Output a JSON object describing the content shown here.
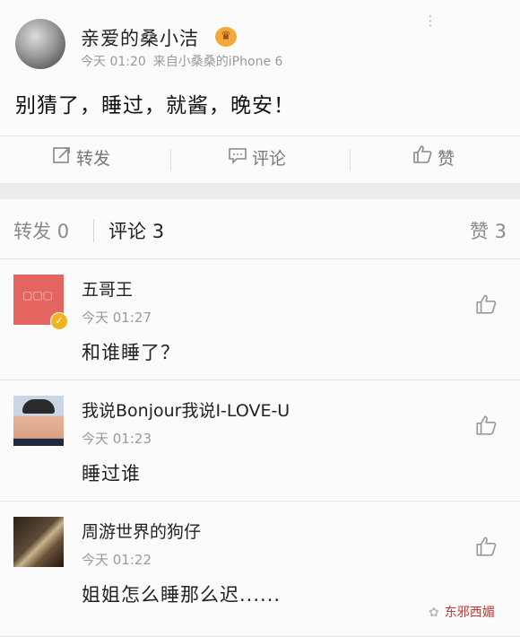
{
  "post": {
    "username": "亲爱的桑小洁",
    "time": "今天 01:20",
    "source": "来自小桑桑的iPhone 6",
    "text": "别猜了，睡过，就酱，晚安！",
    "more_icon": "more-icon"
  },
  "actions": {
    "forward_label": "转发",
    "comment_label": "评论",
    "like_label": "赞"
  },
  "tabs": {
    "forward_label": "转发",
    "forward_count": "0",
    "comment_label": "评论",
    "comment_count": "3",
    "like_label": "赞",
    "like_count": "3"
  },
  "comments": [
    {
      "name": "五哥王",
      "time": "今天 01:27",
      "text": "和谁睡了？"
    },
    {
      "name": "我说Bonjour我说I-LOVE-U",
      "time": "今天 01:23",
      "text": "睡过谁"
    },
    {
      "name": "周游世界的狗仔",
      "time": "今天 01:22",
      "text": "姐姐怎么睡那么迟......"
    }
  ],
  "watermark": {
    "text": "东邪西媚"
  },
  "colors": {
    "accent": "#f0b422",
    "watermark": "#cc3333",
    "muted": "#9a9a9a"
  }
}
